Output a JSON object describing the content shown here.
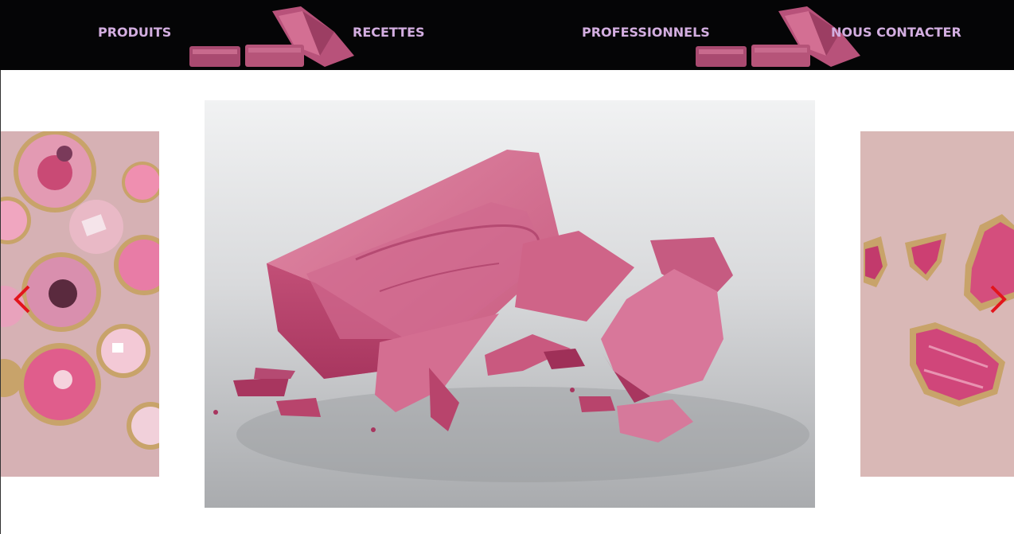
{
  "nav": {
    "items": [
      {
        "label": "PRODUITS"
      },
      {
        "label": "RECETTES"
      },
      {
        "label": "PROFESSIONNELS"
      },
      {
        "label": "NOUS CONTACTER"
      }
    ]
  },
  "colors": {
    "header_bg": "#050506",
    "nav_text": "#d3aee0",
    "ruby_chocolate": "#c9607f",
    "arrow": "#e2151c"
  },
  "icons": {
    "prev": "chevron-left-icon",
    "next": "chevron-right-icon"
  }
}
